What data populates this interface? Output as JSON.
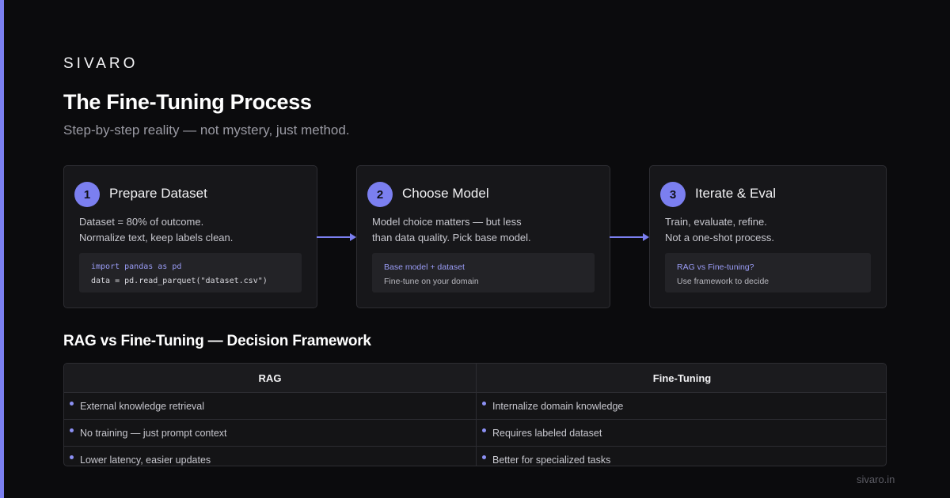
{
  "brand": "SIVARO",
  "title": "The Fine-Tuning Process",
  "subtitle": "Step-by-step reality — not mystery, just method.",
  "accent_color": "#7b7ff0",
  "steps": [
    {
      "number": "1",
      "title": "Prepare Dataset",
      "desc": [
        "Dataset = 80% of outcome.",
        "Normalize text, keep labels clean."
      ],
      "code": [
        "import pandas as pd",
        "data = pd.read_parquet(\"dataset.csv\")"
      ]
    },
    {
      "number": "2",
      "title": "Choose Model",
      "desc": [
        "Model choice matters — but less",
        "than data quality. Pick base model."
      ],
      "box": [
        "Base model + dataset",
        "Fine-tune on your domain"
      ]
    },
    {
      "number": "3",
      "title": "Iterate & Eval",
      "desc": [
        "Train, evaluate, refine.",
        "Not a one-shot process."
      ],
      "box": [
        "RAG vs Fine-tuning?",
        "Use framework to decide"
      ]
    }
  ],
  "framework": {
    "title": "RAG vs Fine-Tuning — Decision Framework",
    "headers": [
      "RAG",
      "Fine-Tuning"
    ],
    "rows": [
      [
        "External knowledge retrieval",
        "Internalize domain knowledge"
      ],
      [
        "No training — just prompt context",
        "Requires labeled dataset"
      ],
      [
        "Lower latency, easier updates",
        "Better for specialized tasks"
      ]
    ]
  },
  "footer": "sivaro.in"
}
